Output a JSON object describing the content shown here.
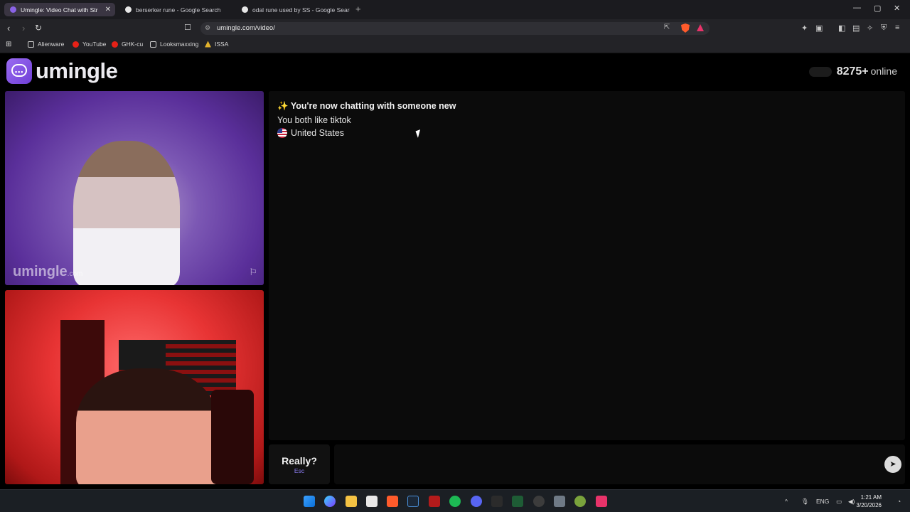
{
  "browser": {
    "tabs": [
      {
        "label": "Umingle: Video Chat with Str",
        "active": true
      },
      {
        "label": "berserker rune - Google Search",
        "active": false
      },
      {
        "label": "odal rune used by SS - Google Search",
        "active": false
      }
    ],
    "url": "umingle.com/video/",
    "bookmarks": [
      "Alienware",
      "YouTube",
      "GHK-cu",
      "Looksmaxxing",
      "ISSA"
    ]
  },
  "site": {
    "logo": "umingle",
    "online_count": "8275+",
    "online_label": "online",
    "watermark_main": "umingle",
    "watermark_suffix": ".com"
  },
  "chat": {
    "title": "You're now chatting with someone new",
    "title_emoji": "✨",
    "shared_interest": "You both like tiktok",
    "country": "United States"
  },
  "controls": {
    "escape_label": "Really?",
    "escape_hint": "Esc",
    "message_placeholder": "",
    "send_icon": "send-icon"
  },
  "taskbar": {
    "language": "ENG",
    "time": "1:21 AM",
    "date": "3/20/2026"
  }
}
